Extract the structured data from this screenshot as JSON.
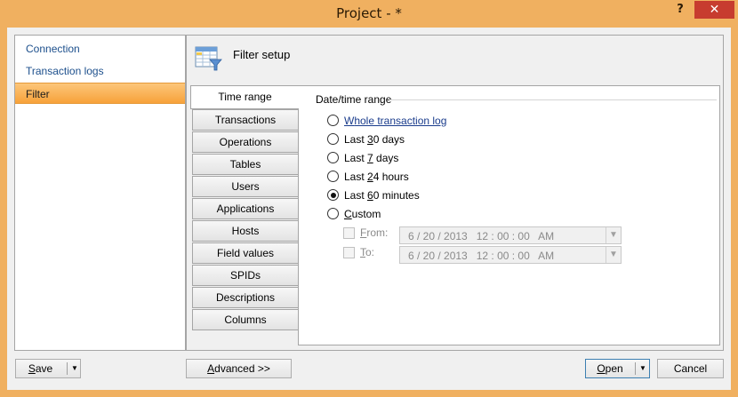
{
  "window": {
    "title": "Project - *",
    "help_label": "?",
    "close_label": "✕"
  },
  "nav": {
    "items": [
      {
        "label": "Connection"
      },
      {
        "label": "Transaction logs"
      },
      {
        "label": "Filter"
      }
    ],
    "selected": "Filter"
  },
  "header": {
    "title": "Filter setup",
    "icon": "table-filter-icon"
  },
  "tabs": {
    "active": "Time range",
    "items": [
      {
        "label": "Transactions"
      },
      {
        "label": "Operations"
      },
      {
        "label": "Tables"
      },
      {
        "label": "Users"
      },
      {
        "label": "Applications"
      },
      {
        "label": "Hosts"
      },
      {
        "label": "Field values"
      },
      {
        "label": "SPIDs"
      },
      {
        "label": "Descriptions"
      },
      {
        "label": "Columns"
      }
    ]
  },
  "time_range": {
    "group_label": "Date/time range",
    "options": [
      {
        "pre": "",
        "key": "W",
        "post": "hole transaction log"
      },
      {
        "pre": "Last ",
        "key": "3",
        "post": "0 days"
      },
      {
        "pre": "Last ",
        "key": "7",
        "post": " days"
      },
      {
        "pre": "Last ",
        "key": "2",
        "post": "4 hours"
      },
      {
        "pre": "Last ",
        "key": "6",
        "post": "0 minutes"
      },
      {
        "pre": "",
        "key": "C",
        "post": "ustom"
      }
    ],
    "selected_index": 4,
    "from": {
      "key": "F",
      "post": "rom:",
      "value": "6 / 20 / 2013   12 : 00 : 00   AM"
    },
    "to": {
      "key": "T",
      "post": "o:",
      "value": "6 / 20 / 2013   12 : 00 : 00   AM"
    }
  },
  "buttons": {
    "save": {
      "key": "S",
      "post": "ave"
    },
    "advanced": {
      "key": "A",
      "post": "dvanced >>"
    },
    "open": {
      "key": "O",
      "post": "pen"
    },
    "cancel": "Cancel",
    "dropdown_arrow": "▼"
  },
  "colors": {
    "title_bar": "#f0b060",
    "close_button": "#c73c2f",
    "selected_nav": "#f7a23a",
    "link_text": "#1c4f8c"
  }
}
